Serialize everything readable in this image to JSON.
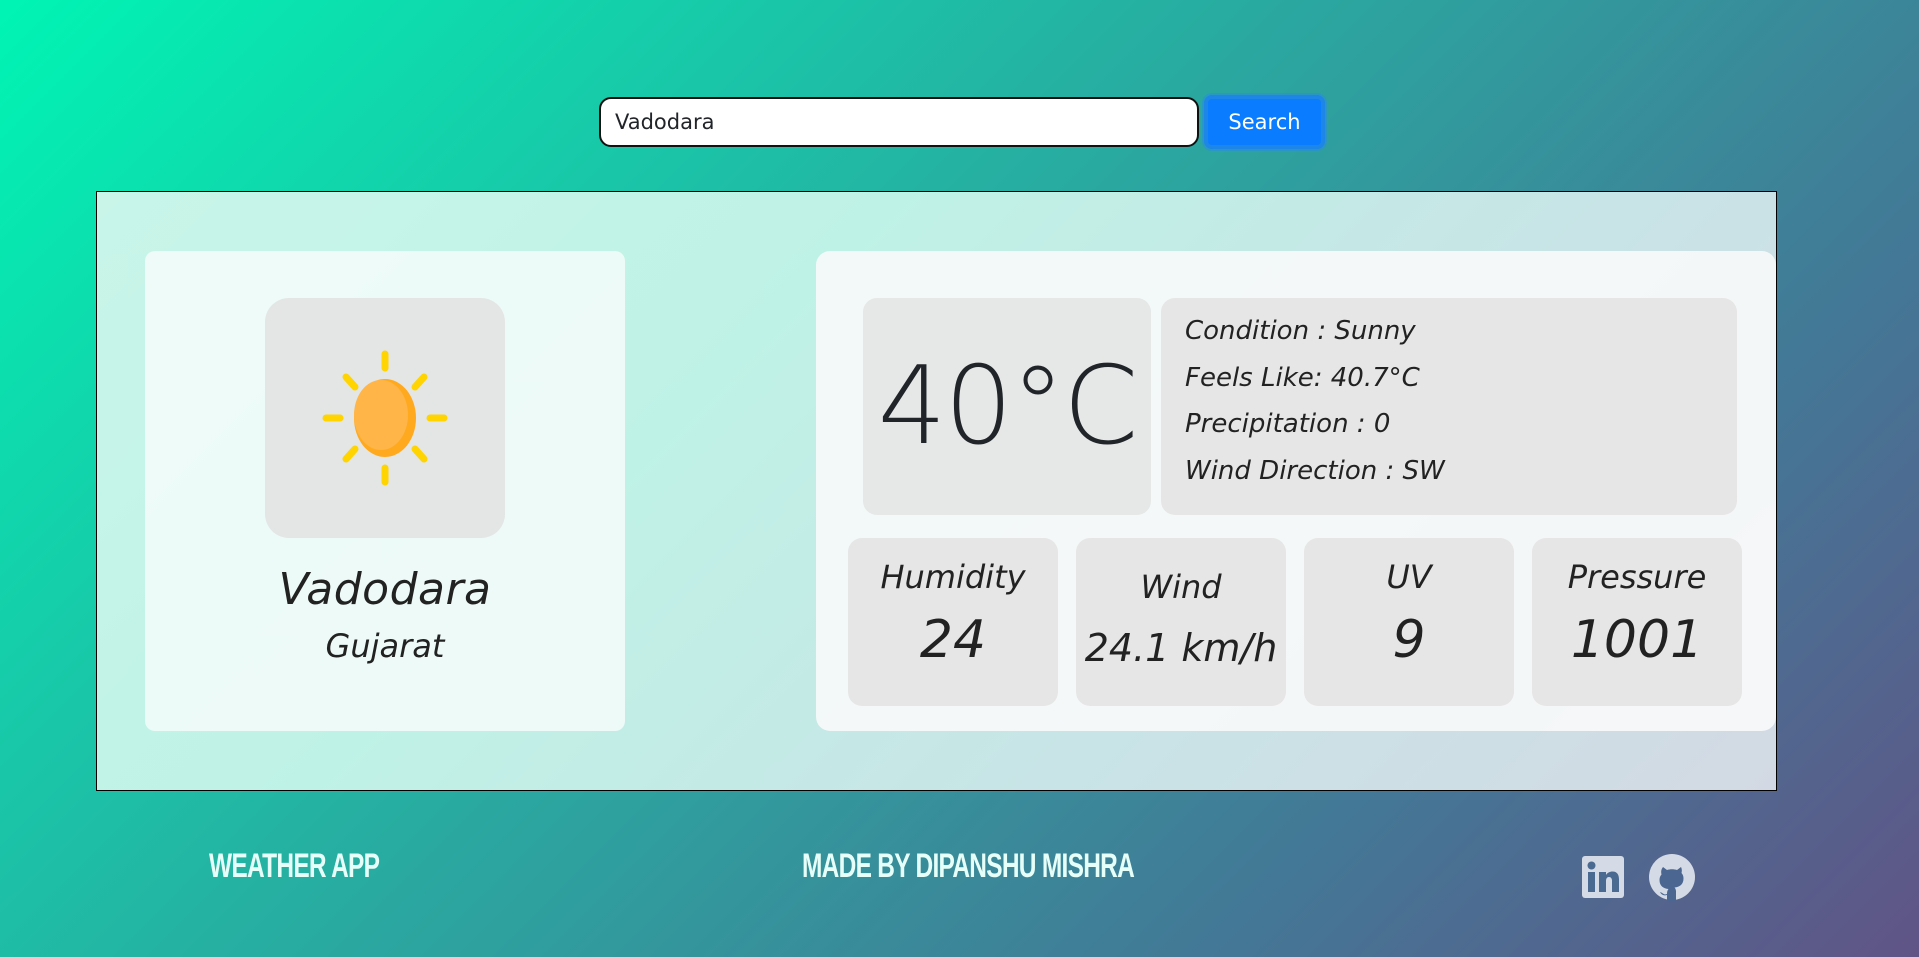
{
  "search": {
    "value": "Vadodara",
    "button_label": "Search"
  },
  "location": {
    "icon": "sun-icon",
    "city": "Vadodara",
    "region": "Gujarat"
  },
  "current": {
    "temperature": "40°C",
    "details": [
      "Condition : Sunny",
      "Feels Like: 40.7°C",
      "Precipitation : 0",
      "Wind Direction : SW"
    ]
  },
  "stats": [
    {
      "label": "Humidity",
      "value": "24"
    },
    {
      "label": "Wind",
      "value": "24.1 km/h"
    },
    {
      "label": "UV",
      "value": "9"
    },
    {
      "label": "Pressure",
      "value": "1001"
    }
  ],
  "footer": {
    "app_name": "WEATHER APP",
    "credit": "MADE BY DIPANSHU MISHRA",
    "links": [
      {
        "icon": "linkedin-icon"
      },
      {
        "icon": "github-icon"
      }
    ]
  },
  "colors": {
    "button": "#0a7cff",
    "gradient_start": "#00f5b4",
    "gradient_end": "#605486",
    "sun_body": "#ffb240",
    "sun_rays": "#ffd400"
  }
}
